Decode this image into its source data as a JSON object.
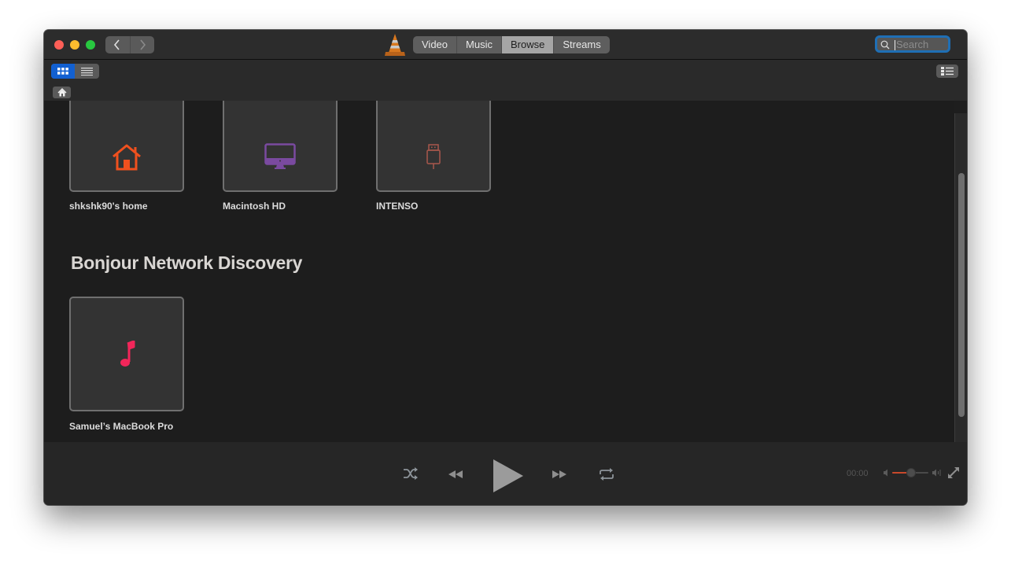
{
  "window": {
    "traffic_lights": {
      "close": "#fe5f57",
      "minimize": "#febc2e",
      "zoom": "#28c840"
    }
  },
  "nav": {
    "back_icon": "chevron-left-icon",
    "forward_icon": "chevron-right-icon"
  },
  "tabs": [
    {
      "label": "Video",
      "active": false
    },
    {
      "label": "Music",
      "active": false
    },
    {
      "label": "Browse",
      "active": true
    },
    {
      "label": "Streams",
      "active": false
    }
  ],
  "search": {
    "placeholder": "Search",
    "value": ""
  },
  "toolbar": {
    "view_mode": "grid"
  },
  "locations": [
    {
      "name": "shkshk90's home",
      "icon": "home-icon",
      "color": "#f0501e"
    },
    {
      "name": "Macintosh HD",
      "icon": "imac-icon",
      "color": "#7a4aa0"
    },
    {
      "name": "INTENSO",
      "icon": "usb-drive-icon",
      "color": "#a9584c"
    }
  ],
  "bonjour": {
    "title": "Bonjour Network Discovery",
    "items": [
      {
        "name": "Samuel’s MacBook Pro",
        "icon": "music-note-icon",
        "color": "#f2265a"
      }
    ]
  },
  "player": {
    "time": "00:00",
    "volume_fraction": 0.5,
    "accent": "#c8492b"
  }
}
